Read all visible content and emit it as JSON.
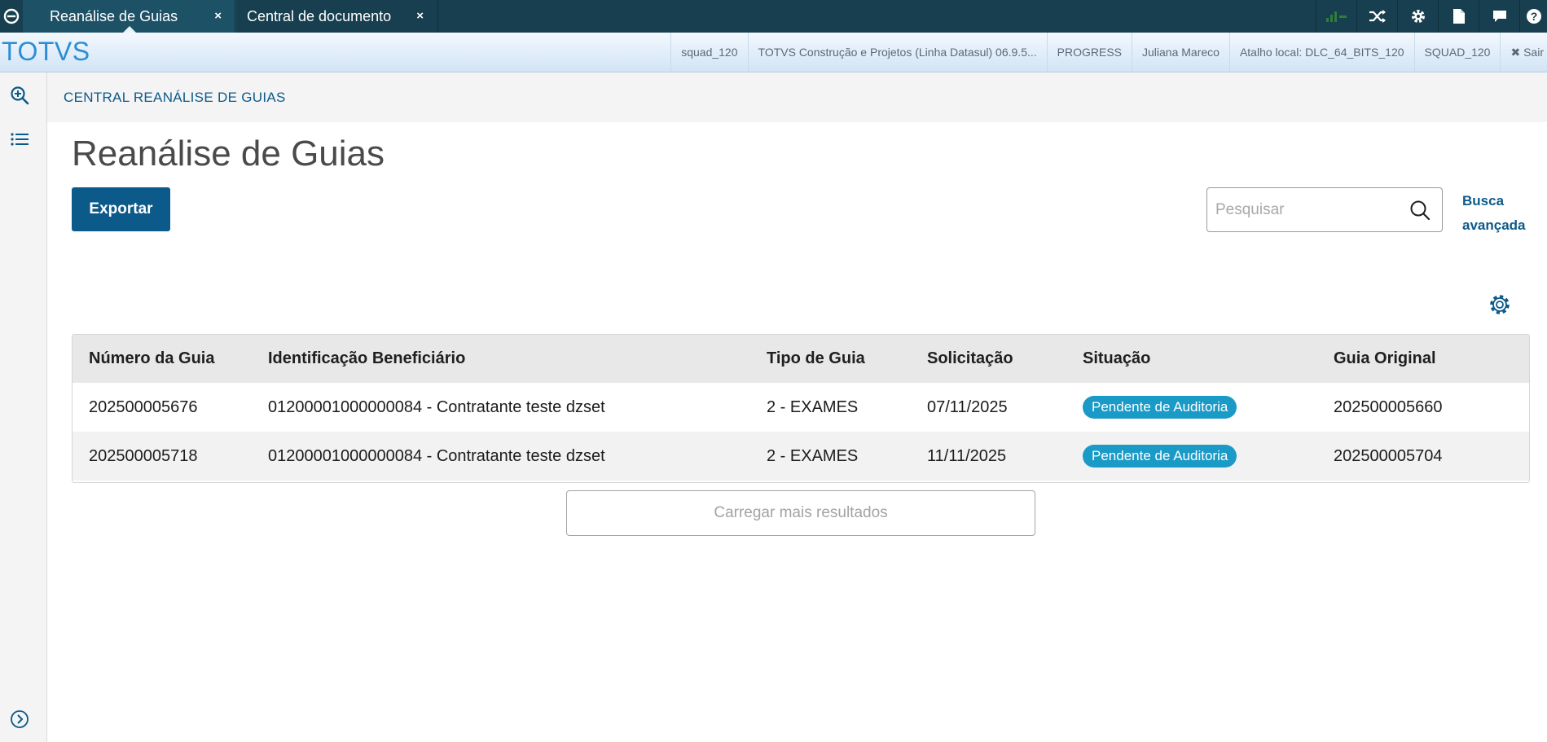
{
  "tabs": [
    {
      "label": "Reanálise de Guias",
      "close": "×",
      "active": true
    },
    {
      "label": "Central de documento",
      "close": "×",
      "active": false
    }
  ],
  "top_icons": [
    "signal-icon",
    "shuffle-icon",
    "gear-icon",
    "document-icon",
    "chat-icon",
    "help-icon"
  ],
  "brand": "TOTVS",
  "info_bar": {
    "items": [
      "squad_120",
      "TOTVS Construção e Projetos (Linha Datasul) 06.9.5...",
      "PROGRESS",
      "Juliana Mareco",
      "Atalho local: DLC_64_BITS_120",
      "SQUAD_120"
    ],
    "logout": "✖ Sair"
  },
  "sidebar_icons": [
    "zoom-in-icon",
    "list-icon",
    "expand-icon"
  ],
  "breadcrumb": "CENTRAL REANÁLISE DE GUIAS",
  "page": {
    "title": "Reanálise de Guias",
    "export_label": "Exportar",
    "search_placeholder": "Pesquisar",
    "advanced_search_line1": "Busca",
    "advanced_search_line2": "avançada",
    "load_more": "Carregar mais resultados"
  },
  "table": {
    "columns": [
      "Número da Guia",
      "Identificação Beneficiário",
      "Tipo de Guia",
      "Solicitação",
      "Situação",
      "Guia Original"
    ],
    "rows": [
      [
        "202500005676",
        "01200001000000084 - Contratante teste dzset",
        "2 - EXAMES",
        "07/11/2025",
        "Pendente de Auditoria",
        "202500005660"
      ],
      [
        "202500005718",
        "01200001000000084 - Contratante teste dzset",
        "2 - EXAMES",
        "11/11/2025",
        "Pendente de Auditoria",
        "202500005704"
      ]
    ]
  },
  "colors": {
    "topbar": "#173f4f",
    "primary": "#0c5a8a",
    "badge": "#1a9ac6",
    "brand": "#2a8ed6"
  }
}
